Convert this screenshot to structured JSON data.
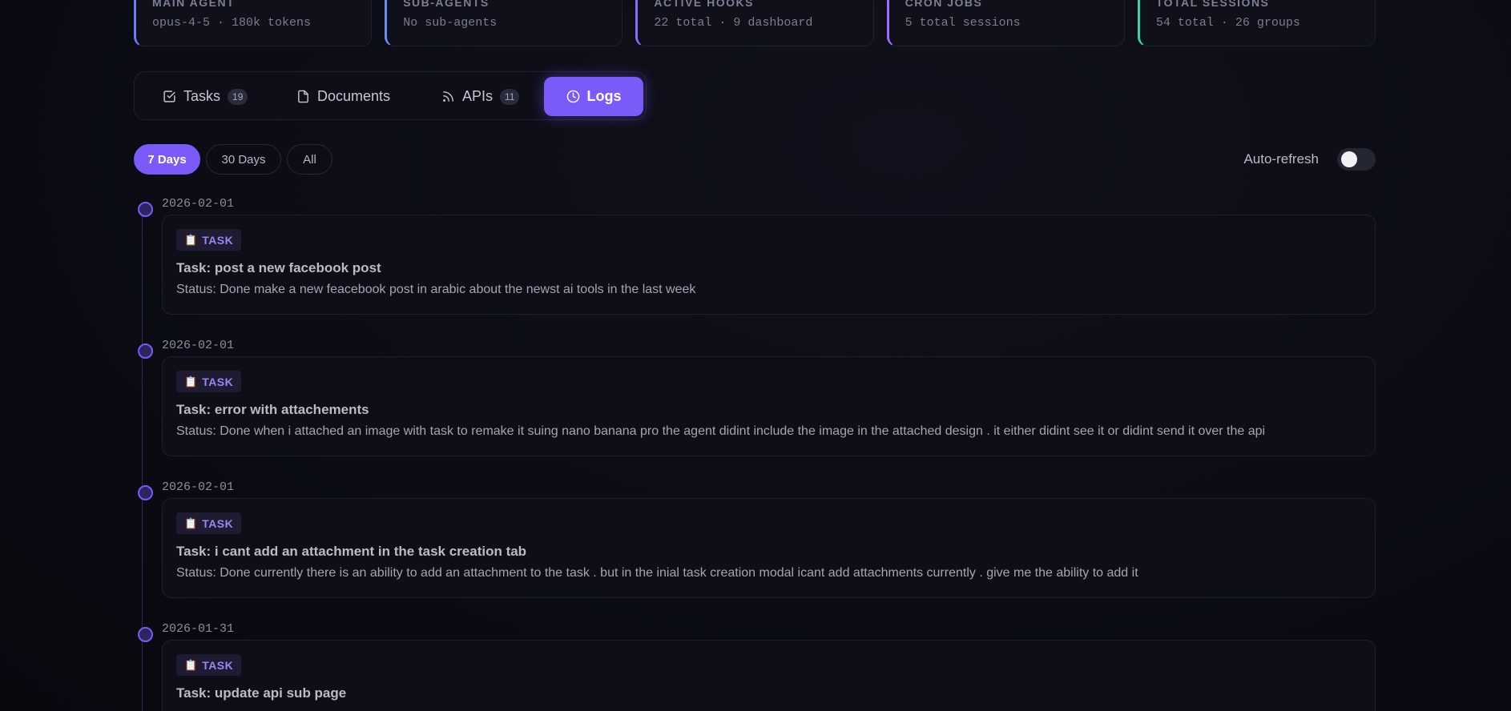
{
  "stats": [
    {
      "label": "MAIN AGENT",
      "sub": "opus-4-5 · 180k tokens",
      "accent": "#6b7cff"
    },
    {
      "label": "SUB-AGENTS",
      "sub": "No sub-agents",
      "accent": "#6b8cff"
    },
    {
      "label": "ACTIVE HOOKS",
      "sub": "22 total · 9 dashboard",
      "accent": "#8d6bff"
    },
    {
      "label": "CRON JOBS",
      "sub": "5 total sessions",
      "accent": "#a06bff"
    },
    {
      "label": "TOTAL SESSIONS",
      "sub": "54 total · 26 groups",
      "accent": "#3fd1b0"
    }
  ],
  "tabs": {
    "tasks": {
      "label": "Tasks",
      "count": "19",
      "icon": "checkbox-icon"
    },
    "documents": {
      "label": "Documents",
      "icon": "document-icon"
    },
    "apis": {
      "label": "APIs",
      "count": "11",
      "icon": "rss-icon"
    },
    "logs": {
      "label": "Logs",
      "icon": "clock-icon",
      "active": true
    }
  },
  "filters": {
    "seven_days": "7 Days",
    "thirty_days": "30 Days",
    "all": "All",
    "selected": "7 Days"
  },
  "auto_refresh": {
    "label": "Auto-refresh",
    "enabled": false
  },
  "accent_color": "#7a5af8",
  "logs": [
    {
      "date": "2026-02-01",
      "badge_icon": "📋",
      "badge": "TASK",
      "title": "Task: post a new facebook post",
      "status": "Status: Done make a new feacebook post in arabic about the newst ai tools in the last week"
    },
    {
      "date": "2026-02-01",
      "badge_icon": "📋",
      "badge": "TASK",
      "title": "Task: error with attachements",
      "status": "Status: Done when i attached an image with task to remake it suing nano banana pro the agent didint include the image in the attached design . it either didint see it or didint send it over the api"
    },
    {
      "date": "2026-02-01",
      "badge_icon": "📋",
      "badge": "TASK",
      "title": "Task: i cant add an attachment in the task creation tab",
      "status": "Status: Done currently there is an ability to add an attachment to the task . but in the inial task creation modal icant add attachments currently . give me the ability to add it"
    },
    {
      "date": "2026-01-31",
      "badge_icon": "📋",
      "badge": "TASK",
      "title": "Task: update api sub page",
      "status": ""
    }
  ]
}
